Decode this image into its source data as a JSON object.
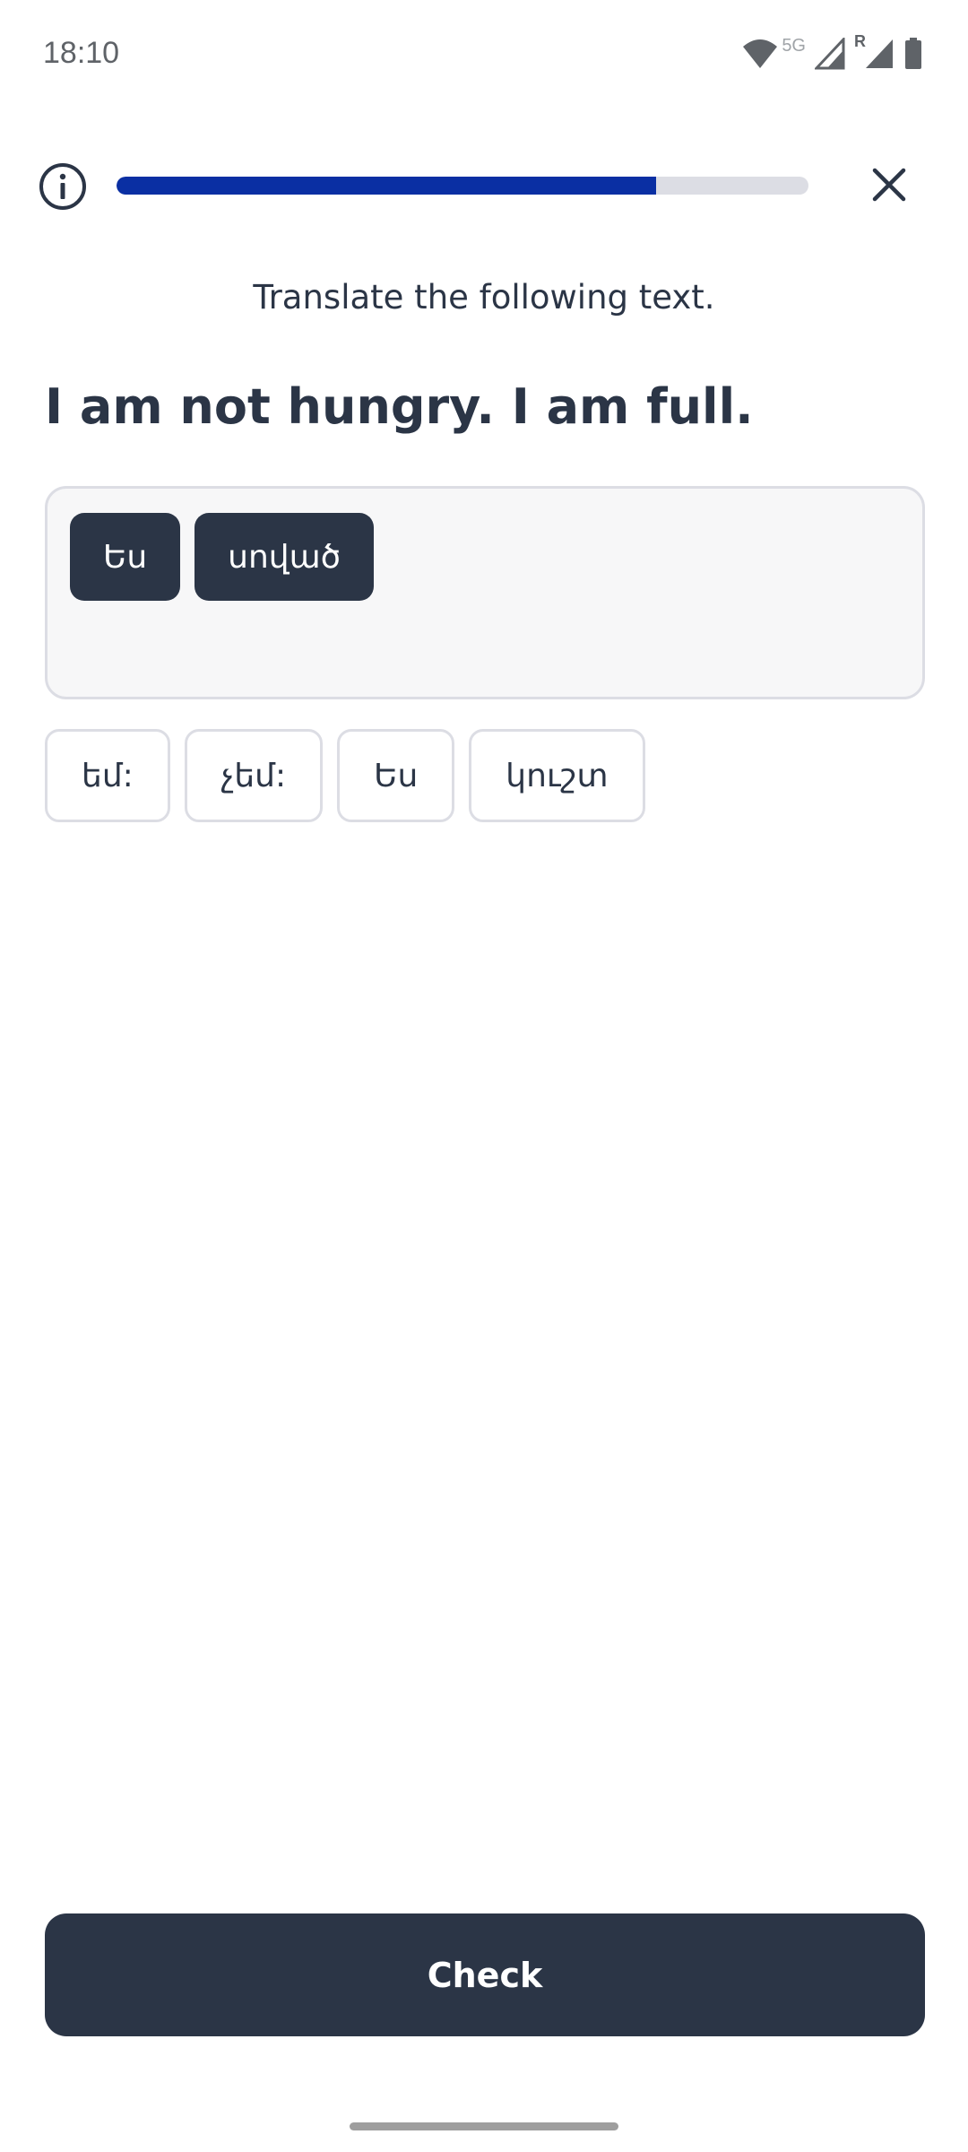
{
  "status_bar": {
    "time": "18:10",
    "network_label": "5G",
    "roaming_label": "R",
    "icons": [
      "wifi-icon",
      "signal-icon",
      "roaming-signal-icon",
      "battery-icon"
    ]
  },
  "header": {
    "info_icon": "info-icon",
    "close_icon": "close-icon",
    "progress_fraction": 0.78
  },
  "exercise": {
    "instruction": "Translate the following text.",
    "sentence": "I am not hungry. I am full."
  },
  "answer": {
    "selected": [
      "Ես",
      "սոված"
    ]
  },
  "word_bank": {
    "options": [
      "եմ:",
      "չեմ:",
      "Ես",
      "կուշտ"
    ]
  },
  "footer": {
    "check_label": "Check"
  },
  "colors": {
    "accent": "#0a2fa3",
    "dark": "#2b3546",
    "track": "#dcdde4",
    "answer_bg": "#f7f7f8"
  }
}
